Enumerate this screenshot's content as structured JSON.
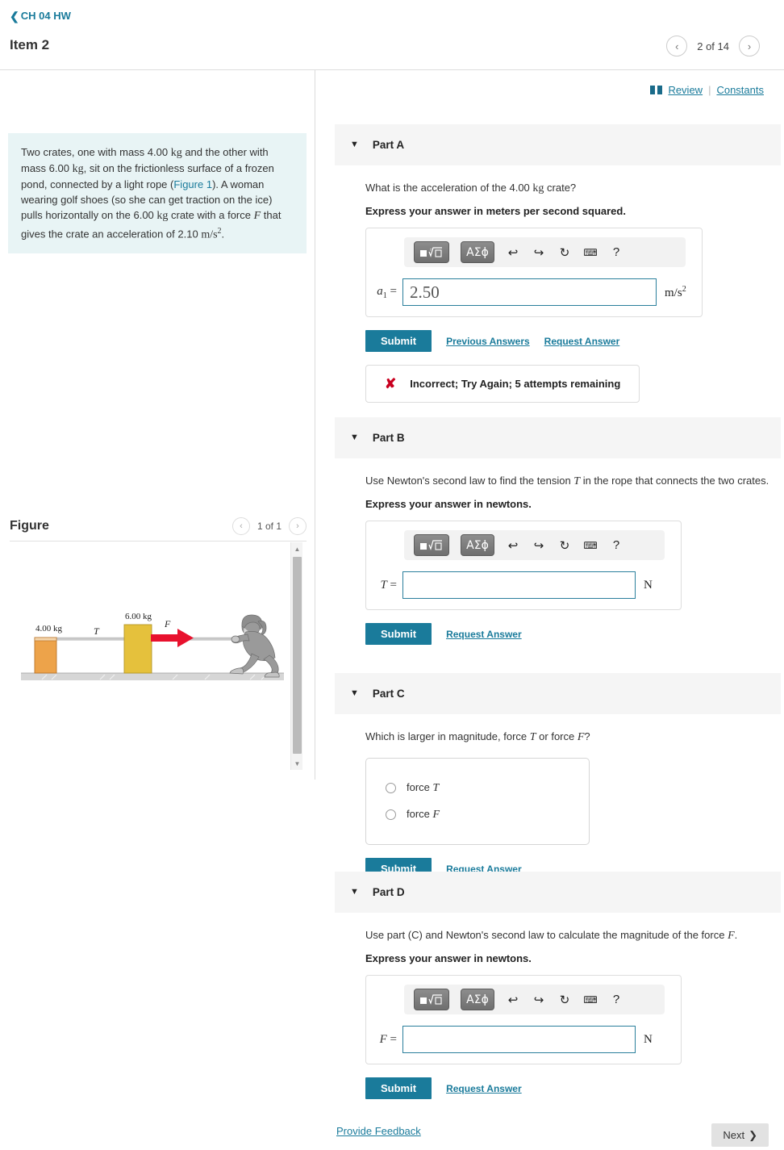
{
  "header": {
    "back_label": "CH 04 HW",
    "back_chevron": "chevron-left-icon",
    "item_title": "Item 2",
    "item_count": "2 of 14",
    "prev_icon": "‹",
    "next_icon": "›"
  },
  "review_bar": {
    "review_label": "Review",
    "separator": "|",
    "constants_label": "Constants",
    "book_icon": "book-icon"
  },
  "statement": {
    "p1": "Two crates, one with mass 4.00 ",
    "kg1": "kg",
    "p2": " and the other with mass 6.00 ",
    "kg2": "kg",
    "p3": ", sit on the frictionless surface of a frozen pond, connected by a light rope (",
    "figure_link": "Figure 1",
    "p4": "). A woman wearing golf shoes (so she can get traction on the ice) pulls horizontally on the 6.00 ",
    "kg3": "kg",
    "p5": " crate with a force ",
    "F": "F",
    "p6": " that gives the crate an acceleration of 2.10 ",
    "units": "m/s",
    "exp": "2",
    "p7": "."
  },
  "figure": {
    "title": "Figure",
    "count": "1 of 1",
    "prev_icon": "‹",
    "next_icon": "›",
    "labels": {
      "mass_left": "4.00 kg",
      "mass_right": "6.00 kg",
      "tension": "T",
      "force": "F"
    },
    "colors": {
      "crate_left": "#eda34a",
      "crate_right": "#e5c13c",
      "force_arrow": "#e8112d",
      "ground": "#d4d4d4",
      "person": "#9a9a9a"
    }
  },
  "toolbar": {
    "template_btn": "template-icon",
    "greek_btn": "ΑΣϕ",
    "undo_icon": "↩",
    "redo_icon": "↪",
    "reset_icon": "↻",
    "keyboard_icon": "keyboard-icon",
    "help_icon": "?"
  },
  "common": {
    "submit_label": "Submit",
    "request_answer_label": "Request Answer",
    "previous_answers_label": "Previous Answers",
    "caret": "▼"
  },
  "parts": [
    {
      "id": "A",
      "label": "Part A",
      "question_pre": "What is the acceleration of the 4.00 ",
      "question_unit": "kg",
      "question_post": " crate?",
      "instruction": "Express your answer in meters per second squared.",
      "lhs_var": "a",
      "lhs_sub": "1",
      "value": "2.50",
      "unit": "m/s",
      "unit_exp": "2",
      "has_previous_answers": true,
      "feedback": {
        "icon": "x-mark-icon",
        "text": "Incorrect; Try Again; 5 attempts remaining"
      }
    },
    {
      "id": "B",
      "label": "Part B",
      "question_pre": "Use Newton's second law to find the tension ",
      "question_var": "T",
      "question_post": " in the rope that connects the two crates.",
      "instruction": "Express your answer in newtons.",
      "lhs_var": "T",
      "value": "",
      "unit": "N",
      "has_previous_answers": false
    },
    {
      "id": "C",
      "label": "Part C",
      "question_pre": "Which is larger in magnitude, force ",
      "question_var1": "T",
      "question_mid": " or force ",
      "question_var2": "F",
      "question_post": "?",
      "choices": [
        {
          "prefix": "force ",
          "var": "T"
        },
        {
          "prefix": "force ",
          "var": "F"
        }
      ],
      "has_previous_answers": false
    },
    {
      "id": "D",
      "label": "Part D",
      "question_pre": "Use part (C) and Newton's second law to calculate the magnitude of the force ",
      "question_var": "F",
      "question_post": ".",
      "instruction": "Express your answer in newtons.",
      "lhs_var": "F",
      "value": "",
      "unit": "N",
      "has_previous_answers": false
    }
  ],
  "footer": {
    "provide_feedback": "Provide Feedback",
    "next_label": "Next",
    "next_icon": "❯"
  }
}
